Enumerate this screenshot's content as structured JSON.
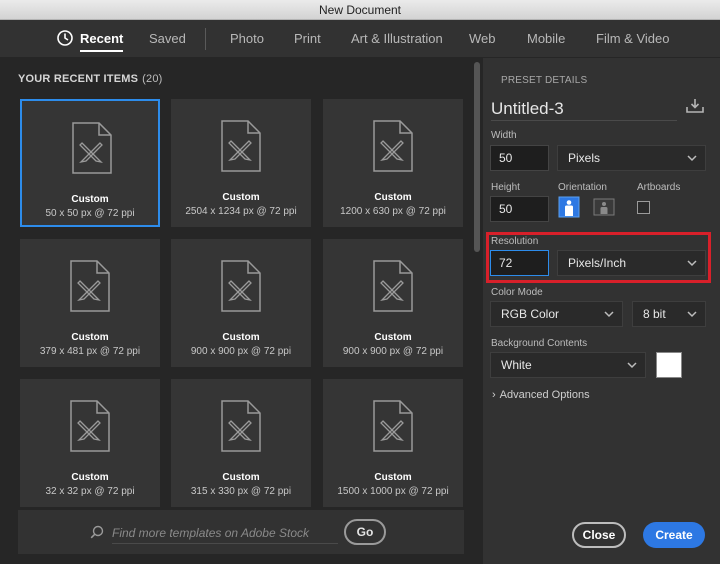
{
  "window": {
    "title": "New Document"
  },
  "tabs": [
    {
      "label": "Recent",
      "icon": "clock-icon"
    },
    {
      "label": "Saved"
    },
    {
      "label": "Photo"
    },
    {
      "label": "Print"
    },
    {
      "label": "Art & Illustration"
    },
    {
      "label": "Web"
    },
    {
      "label": "Mobile"
    },
    {
      "label": "Film & Video"
    }
  ],
  "recent": {
    "heading": "YOUR RECENT ITEMS",
    "count": "(20)",
    "items": [
      {
        "title": "Custom",
        "details": "50 x 50 px @ 72 ppi"
      },
      {
        "title": "Custom",
        "details": "2504 x 1234 px @ 72 ppi"
      },
      {
        "title": "Custom",
        "details": "1200 x 630 px @ 72 ppi"
      },
      {
        "title": "Custom",
        "details": "379 x 481 px @ 72 ppi"
      },
      {
        "title": "Custom",
        "details": "900 x 900 px @ 72 ppi"
      },
      {
        "title": "Custom",
        "details": "900 x 900 px @ 72 ppi"
      },
      {
        "title": "Custom",
        "details": "32 x 32 px @ 72 ppi"
      },
      {
        "title": "Custom",
        "details": "315 x 330 px @ 72 ppi"
      },
      {
        "title": "Custom",
        "details": "1500 x 1000 px @ 72 ppi"
      }
    ]
  },
  "stock": {
    "placeholder": "Find more templates on Adobe Stock",
    "go_label": "Go"
  },
  "preset": {
    "section_label": "PRESET DETAILS",
    "document_name": "Untitled-3",
    "width_label": "Width",
    "width_value": "50",
    "width_unit": "Pixels",
    "height_label": "Height",
    "height_value": "50",
    "orientation_label": "Orientation",
    "artboards_label": "Artboards",
    "resolution_label": "Resolution",
    "resolution_value": "72",
    "resolution_unit": "Pixels/Inch",
    "color_mode_label": "Color Mode",
    "color_mode": "RGB Color",
    "bit_depth": "8 bit",
    "background_label": "Background Contents",
    "background": "White",
    "background_color": "#ffffff",
    "advanced_label": "Advanced Options"
  },
  "buttons": {
    "close": "Close",
    "create": "Create"
  },
  "colors": {
    "accent": "#2d78e3",
    "selection": "#2d8ceb",
    "highlight": "#d8202a"
  }
}
